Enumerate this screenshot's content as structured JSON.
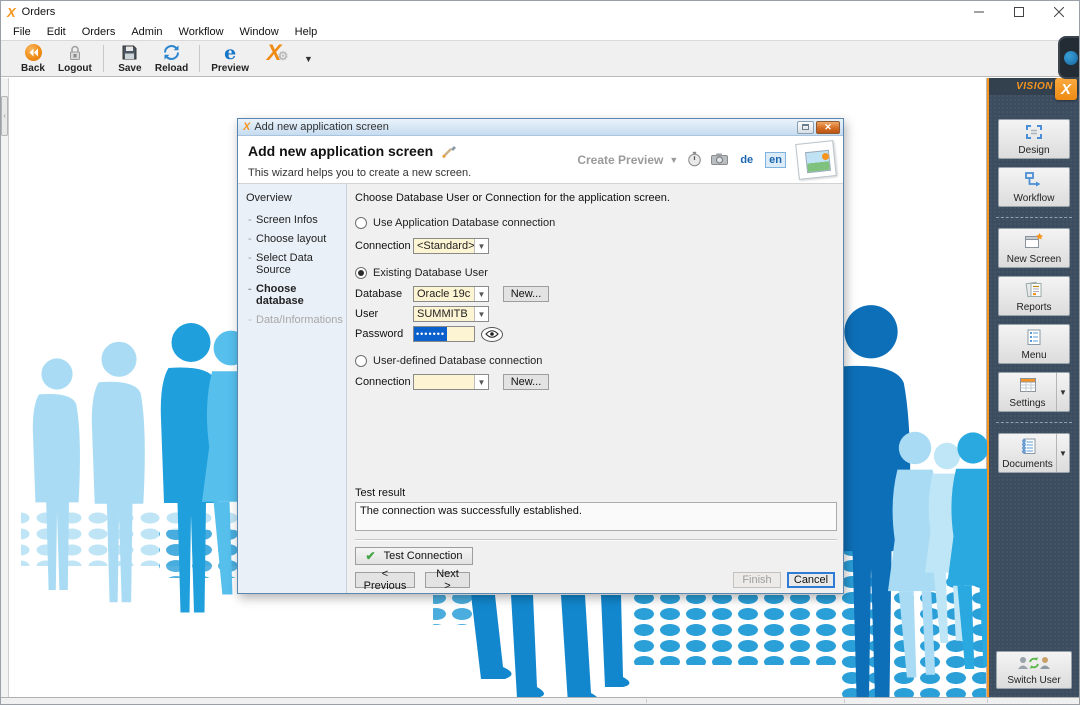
{
  "window": {
    "title": "Orders",
    "menu": [
      "File",
      "Edit",
      "Orders",
      "Admin",
      "Workflow",
      "Window",
      "Help"
    ],
    "toolbar": {
      "back": "Back",
      "logout": "Logout",
      "save": "Save",
      "reload": "Reload",
      "preview": "Preview"
    }
  },
  "dialog": {
    "titlebar": "Add new application screen",
    "heading": "Add new application screen",
    "subtitle": "This wizard helps you to create a new screen.",
    "create_preview_label": "Create Preview",
    "lang": {
      "de": "de",
      "en": "en",
      "selected": "en"
    },
    "steps": {
      "header": "Overview",
      "items": [
        {
          "label": "Screen Infos",
          "state": "normal"
        },
        {
          "label": "Choose layout",
          "state": "normal"
        },
        {
          "label": "Select Data Source",
          "state": "normal"
        },
        {
          "label": "Choose database",
          "state": "active"
        },
        {
          "label": "Data/Informations",
          "state": "disabled"
        }
      ]
    },
    "form": {
      "instruction": "Choose Database User or Connection for the application screen.",
      "option_app_connection": "Use Application Database connection",
      "connection_label": "Connection",
      "connection_value": "<Standard>",
      "option_existing_user": "Existing Database User",
      "selected_option": "Existing Database User",
      "database_label": "Database",
      "database_value": "Oracle 19c",
      "new_button": "New...",
      "user_label": "User",
      "user_value": "SUMMITB",
      "password_label": "Password",
      "password_masked": "•••••••",
      "option_user_defined": "User-defined Database connection",
      "connection2_label": "Connection",
      "connection2_value": "",
      "new2_button": "New...",
      "test_result_label": "Test result",
      "test_result_text": "The connection was successfully established.",
      "test_connection_button": "Test Connection",
      "previous_button": "< Previous",
      "next_button": "Next >",
      "finish_button": "Finish",
      "cancel_button": "Cancel"
    }
  },
  "side_panel": {
    "brand": "VISION",
    "brand_x": "X",
    "buttons": [
      {
        "label": "Design",
        "has_dropdown": false
      },
      {
        "label": "Workflow",
        "has_dropdown": false
      },
      {
        "label": "New Screen",
        "has_dropdown": false
      },
      {
        "label": "Reports",
        "has_dropdown": false
      },
      {
        "label": "Menu",
        "has_dropdown": false
      },
      {
        "label": "Settings",
        "has_dropdown": true
      },
      {
        "label": "Documents",
        "has_dropdown": true
      }
    ],
    "switch_user_label": "Switch User"
  },
  "colors": {
    "accent_orange": "#f7941d",
    "blue_medium": "#29a9e1",
    "blue_light": "#a9dcf4",
    "blue_dark": "#0d6fb8",
    "combo_bg": "#fdf4d3",
    "selection_blue": "#0b61cb",
    "panel_bg": "#3c4d60"
  }
}
